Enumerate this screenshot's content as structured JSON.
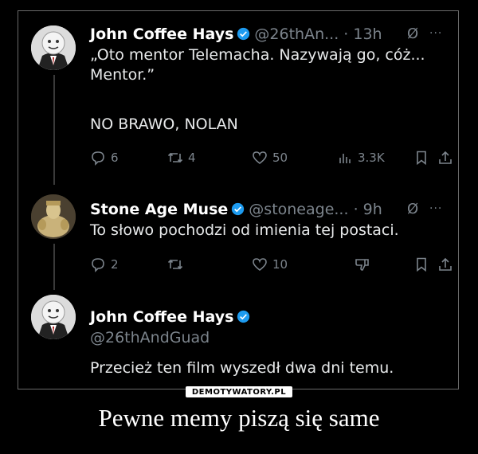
{
  "tweets": [
    {
      "name": "John Coffee Hays",
      "handle": "@26thAn...",
      "dot": "·",
      "time": "13h",
      "mute_icon": "Ø",
      "more_icon": "···",
      "text_lines": [
        "„Oto mentor Telemacha. Nazywają go, cóż...",
        "Mentor.”",
        "",
        "NO BRAWO, NOLAN"
      ],
      "stats": {
        "replies": "6",
        "retweets": "4",
        "likes": "50",
        "views": "3.3K"
      }
    },
    {
      "name": "Stone Age Muse",
      "handle": "@stoneage...",
      "dot": "·",
      "time": "9h",
      "mute_icon": "Ø",
      "more_icon": "···",
      "text_lines": [
        "To słowo pochodzi od imienia tej postaci."
      ],
      "stats": {
        "replies": "2",
        "retweets": "",
        "likes": "10"
      }
    },
    {
      "name": "John Coffee Hays",
      "handle": "@26thAndGuad",
      "text_lines": [
        "Przecież ten film wyszedł dwa dni temu."
      ]
    }
  ],
  "watermark": "DEMOTYWATORY.PL",
  "caption": "Pewne memy piszą się same",
  "colors": {
    "background": "#000000",
    "text": "#e7e9ea",
    "muted": "#7c848c",
    "verified": "#1d9bf0"
  }
}
